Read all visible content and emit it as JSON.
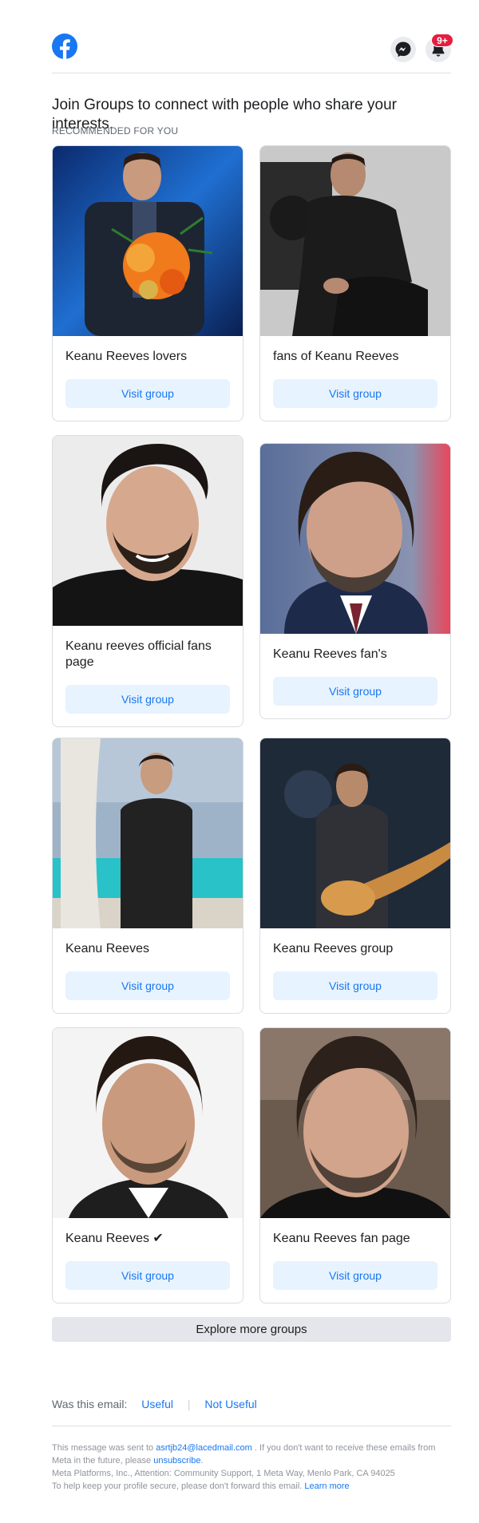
{
  "header": {
    "logo_icon": "facebook-logo-icon",
    "messenger_icon": "messenger-icon",
    "notifications_icon": "bell-icon",
    "notification_badge": "9+"
  },
  "intro": {
    "headline": "Join Groups to connect with people who share your interests.",
    "subhead": "RECOMMENDED FOR YOU"
  },
  "groups": [
    {
      "name": "Keanu Reeves lovers",
      "button": "Visit group"
    },
    {
      "name": "fans of Keanu Reeves",
      "button": "Visit group"
    },
    {
      "name": "Keanu reeves official fans page",
      "button": "Visit group"
    },
    {
      "name": "Keanu Reeves fan's",
      "button": "Visit group"
    },
    {
      "name": "Keanu Reeves",
      "button": "Visit group"
    },
    {
      "name": "Keanu Reeves group",
      "button": "Visit group"
    },
    {
      "name": "Keanu Reeves ✔",
      "button": "Visit group"
    },
    {
      "name": "Keanu Reeves fan page",
      "button": "Visit group"
    }
  ],
  "explore_button": "Explore more groups",
  "feedback": {
    "question": "Was this email:",
    "useful": "Useful",
    "separator": "|",
    "not_useful": "Not Useful"
  },
  "footer": {
    "sent_to_prefix": "This message was sent to",
    "email": "asrtjb24@lacedmail.com",
    "sent_to_suffix": ". If you don't want to receive these emails from Meta in the future, please",
    "unsubscribe": "unsubscribe",
    "period": ".",
    "address": "Meta Platforms, Inc., Attention: Community Support, 1 Meta Way, Menlo Park, CA 94025",
    "security_prefix": "To help keep your profile secure, please don't forward this email.",
    "learn_more": "Learn more"
  },
  "colors": {
    "brand_blue": "#1877f2",
    "badge_red": "#e41e3f",
    "button_bg": "#e7f3ff"
  }
}
